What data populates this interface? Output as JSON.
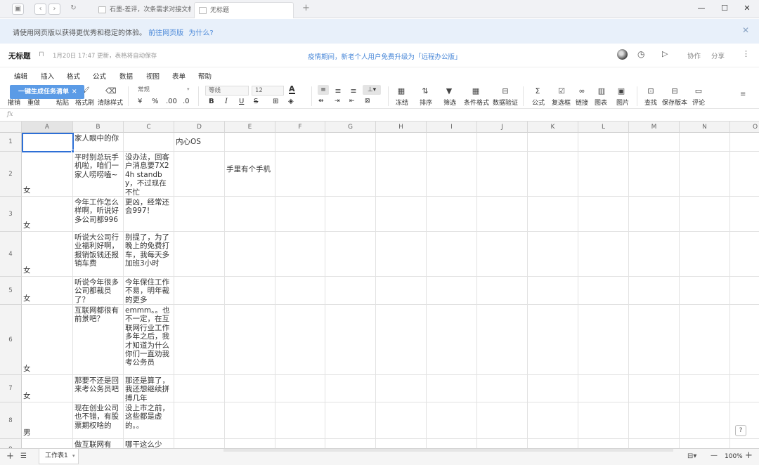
{
  "browser": {
    "tabs": [
      {
        "label": "石墨-差评，次条需求对接文档",
        "active": false
      },
      {
        "label": "无标题",
        "active": true
      }
    ],
    "new_tab": "+"
  },
  "window_controls": {
    "minimize": "—",
    "maximize": "☐",
    "close": "✕"
  },
  "notice": {
    "text": "请使用网页版以获得更优秀和稳定的体验。",
    "link1": "前往网页版",
    "link2": "为什么?"
  },
  "doc": {
    "title": "无标题",
    "meta": "1月20日 17:47 更新，表格将自动保存",
    "promo": "疫情期间，新老个人用户免费升级为「远程办公版」",
    "collab_label": "协作",
    "share_label": "分享"
  },
  "menus": [
    "编辑",
    "插入",
    "格式",
    "公式",
    "数据",
    "视图",
    "表单",
    "帮助"
  ],
  "tooltip": {
    "text": "一键生成任务清单"
  },
  "toolbar": {
    "undo": "撤销",
    "redo": "重做",
    "paste": "粘贴",
    "format_painter": "格式刷",
    "clear_format": "清除样式",
    "number_format": "常规",
    "currency": "¥",
    "percent": "%",
    "dec_add": ".00",
    "dec_remove": ".0",
    "font": "等线",
    "font_size": "12",
    "bold": "B",
    "italic": "I",
    "underline": "U",
    "strike": "S",
    "freeze": "冻结",
    "sort": "排序",
    "filter": "筛选",
    "cond_format": "条件格式",
    "validation": "数据验证",
    "formula": "公式",
    "checkbox": "复选框",
    "link": "链接",
    "chart": "图表",
    "image": "图片",
    "find": "查找",
    "save_version": "保存版本",
    "comment": "评论"
  },
  "formula_bar": {
    "fx": "fx",
    "value": ""
  },
  "sheet": {
    "columns": [
      "A",
      "B",
      "C",
      "D",
      "E",
      "F",
      "G",
      "H",
      "I",
      "J",
      "K",
      "L",
      "M",
      "N",
      "O"
    ],
    "rows": [
      {
        "num": "1",
        "a": "",
        "b": "家人眼中的你",
        "c": "",
        "d": "内心OS",
        "e": ""
      },
      {
        "num": "2",
        "a": "女",
        "b": "平时别总玩手机啦，咱们一家人唠唠嗑~",
        "c": "没办法，回客户消息要7X24h standby，不过现在不忙",
        "d": "",
        "e": "手里有个手机"
      },
      {
        "num": "3",
        "a": "女",
        "b": "今年工作怎么样啊，听说好多公司都996",
        "c": "更凶，经常还会997！",
        "d": "",
        "e": ""
      },
      {
        "num": "4",
        "a": "女",
        "b": "听说大公司行业福利好啊，报销饭钱还报销车费",
        "c": "别提了，为了晚上的免费打车，我每天多加班3小时",
        "d": "",
        "e": ""
      },
      {
        "num": "5",
        "a": "女",
        "b": "听说今年很多公司都裁员了？",
        "c": "今年保住工作不易，明年裁的更多",
        "d": "",
        "e": ""
      },
      {
        "num": "6",
        "a": "女",
        "b": "互联网都很有前景吧？",
        "c": "emmm。。也不一定，在互联网行业工作多年之后，我才知道为什么你们一直劝我考公务员",
        "d": "",
        "e": ""
      },
      {
        "num": "7",
        "a": "女",
        "b": "那要不还是回来考公务员吧",
        "c": "那还是算了，我还想继续拼搏几年",
        "d": "",
        "e": ""
      },
      {
        "num": "8",
        "a": "男",
        "b": "现在创业公司也不错，有股票期权啥的",
        "c": "没上市之前，这些都是虚的。。",
        "d": "",
        "e": ""
      },
      {
        "num": "9",
        "a": "",
        "b": "做互联网有",
        "c": "哪干这么少",
        "d": "",
        "e": ""
      }
    ]
  },
  "bottom": {
    "add": "+",
    "list": "☰",
    "sheet_name": "工作表1",
    "zoom": "100%",
    "minus": "—",
    "plus": "+"
  },
  "colors": {
    "accent": "#4a88d8",
    "tooltip_bg": "#5b9be6",
    "selection": "#2d6fd6",
    "notice_bg": "#e8f0fa"
  }
}
